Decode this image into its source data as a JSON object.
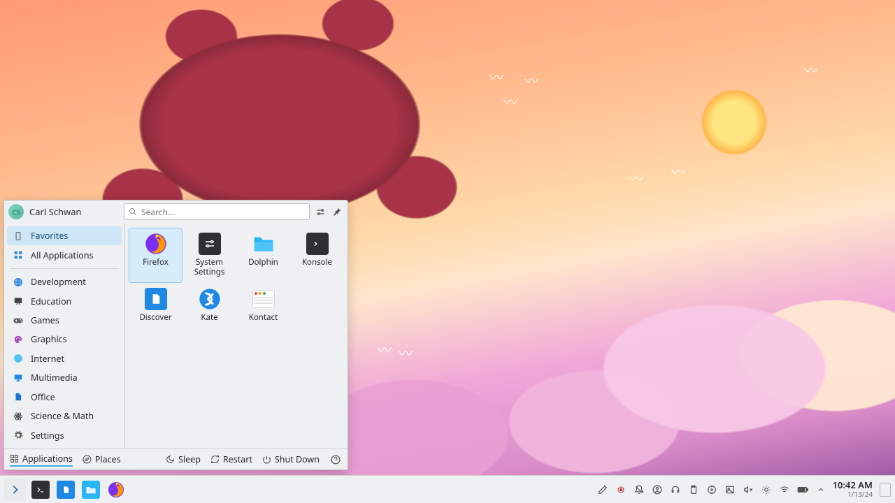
{
  "user": {
    "name": "Carl Schwan",
    "initials": "CS"
  },
  "search": {
    "placeholder": "Search..."
  },
  "sidebar": {
    "items": [
      {
        "label": "Favorites",
        "icon": "bookmark",
        "active": true
      },
      {
        "label": "All Applications",
        "icon": "grid"
      },
      {
        "sep": true
      },
      {
        "label": "Development",
        "icon": "globe-dev"
      },
      {
        "label": "Education",
        "icon": "board"
      },
      {
        "label": "Games",
        "icon": "gamepad"
      },
      {
        "label": "Graphics",
        "icon": "palette"
      },
      {
        "label": "Internet",
        "icon": "globe"
      },
      {
        "label": "Multimedia",
        "icon": "monitor"
      },
      {
        "label": "Office",
        "icon": "doc"
      },
      {
        "label": "Science & Math",
        "icon": "atom"
      },
      {
        "label": "Settings",
        "icon": "gear"
      }
    ]
  },
  "apps": [
    {
      "label": "Firefox",
      "icon": "firefox",
      "selected": true
    },
    {
      "label": "System Settings",
      "icon": "settings"
    },
    {
      "label": "Dolphin",
      "icon": "folder"
    },
    {
      "label": "Konsole",
      "icon": "terminal"
    },
    {
      "label": "Discover",
      "icon": "discover"
    },
    {
      "label": "Kate",
      "icon": "kate"
    },
    {
      "label": "Kontact",
      "icon": "kontact"
    }
  ],
  "footer": {
    "tabs": [
      {
        "label": "Applications",
        "icon": "apps",
        "active": true
      },
      {
        "label": "Places",
        "icon": "compass"
      }
    ],
    "power": [
      {
        "label": "Sleep",
        "icon": "moon"
      },
      {
        "label": "Restart",
        "icon": "refresh"
      },
      {
        "label": "Shut Down",
        "icon": "power"
      }
    ]
  },
  "tray_icons": [
    "pen",
    "record",
    "bell-off",
    "user-circle",
    "headset",
    "clipboard",
    "disc",
    "image",
    "vol-mute",
    "brightness",
    "wifi",
    "battery",
    "chevron-up"
  ],
  "clock": {
    "time": "10:42 AM",
    "date": "1/13/24"
  }
}
